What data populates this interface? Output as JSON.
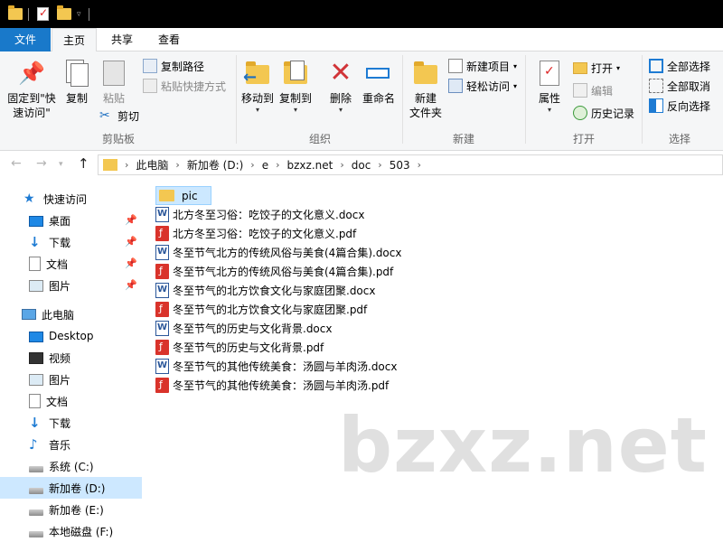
{
  "ribbon_tabs": {
    "file": "文件",
    "home": "主页",
    "share": "共享",
    "view": "查看"
  },
  "clipboard": {
    "pin_label": "固定到\"快\n速访问\"",
    "copy": "复制",
    "paste": "粘贴",
    "copy_path": "复制路径",
    "paste_shortcut": "粘贴快捷方式",
    "cut": "剪切",
    "group": "剪贴板"
  },
  "organize": {
    "move_to": "移动到",
    "copy_to": "复制到",
    "delete": "删除",
    "rename": "重命名",
    "group": "组织"
  },
  "new": {
    "new_item": "新建项目",
    "easy_access": "轻松访问",
    "new_folder": "新建\n文件夹",
    "group": "新建"
  },
  "open": {
    "properties": "属性",
    "open": "打开",
    "edit": "编辑",
    "history": "历史记录",
    "group": "打开"
  },
  "select": {
    "select_all": "全部选择",
    "select_none": "全部取消",
    "invert": "反向选择",
    "group": "选择"
  },
  "breadcrumb": [
    "此电脑",
    "新加卷 (D:)",
    "e",
    "bzxz.net",
    "doc",
    "503"
  ],
  "nav": {
    "quick_access": "快速访问",
    "desktop": "桌面",
    "downloads": "下载",
    "documents": "文档",
    "pictures": "图片",
    "this_pc": "此电脑",
    "pc_desktop": "Desktop",
    "videos": "视频",
    "pc_pictures": "图片",
    "pc_documents": "文档",
    "pc_downloads": "下载",
    "music": "音乐",
    "drive_c": "系统 (C:)",
    "drive_d": "新加卷 (D:)",
    "drive_e": "新加卷 (E:)",
    "drive_f": "本地磁盘 (F:)"
  },
  "files": [
    {
      "name": "pic",
      "type": "folder"
    },
    {
      "name": "北方冬至习俗：吃饺子的文化意义.docx",
      "type": "docx"
    },
    {
      "name": "北方冬至习俗：吃饺子的文化意义.pdf",
      "type": "pdf"
    },
    {
      "name": "冬至节气北方的传统风俗与美食(4篇合集).docx",
      "type": "docx"
    },
    {
      "name": "冬至节气北方的传统风俗与美食(4篇合集).pdf",
      "type": "pdf"
    },
    {
      "name": "冬至节气的北方饮食文化与家庭团聚.docx",
      "type": "docx"
    },
    {
      "name": "冬至节气的北方饮食文化与家庭团聚.pdf",
      "type": "pdf"
    },
    {
      "name": "冬至节气的历史与文化背景.docx",
      "type": "docx"
    },
    {
      "name": "冬至节气的历史与文化背景.pdf",
      "type": "pdf"
    },
    {
      "name": "冬至节气的其他传统美食：汤圆与羊肉汤.docx",
      "type": "docx"
    },
    {
      "name": "冬至节气的其他传统美食：汤圆与羊肉汤.pdf",
      "type": "pdf"
    }
  ],
  "watermark": "bzxz.net",
  "colors": {
    "accent": "#1979ca",
    "folder": "#f3c751",
    "selected": "#cde8ff",
    "pdf": "#d9332b",
    "word": "#2b579a"
  }
}
